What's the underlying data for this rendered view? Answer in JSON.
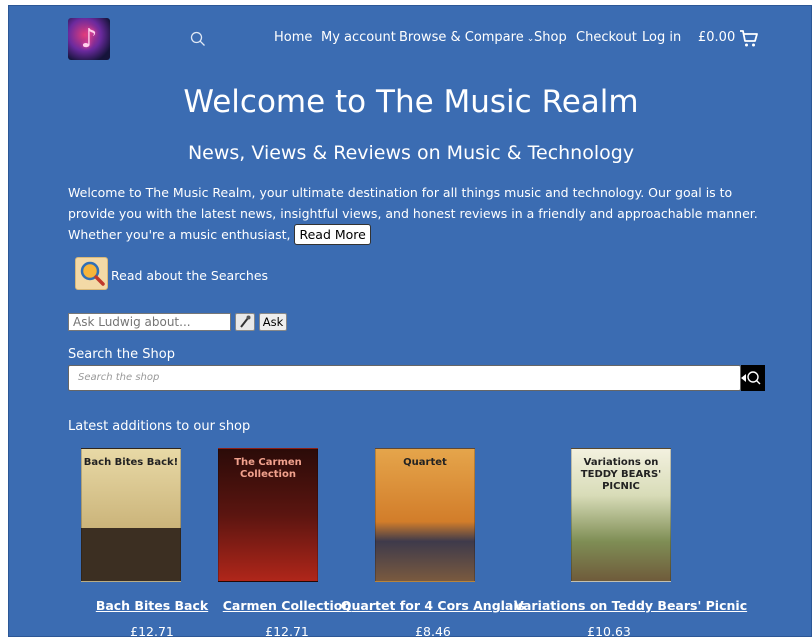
{
  "header": {
    "nav": [
      "Home",
      "My account",
      "Browse & Compare",
      "Shop",
      "Checkout",
      "Log in"
    ],
    "cart_total": "£0.00"
  },
  "hero": {
    "title": "Welcome to The Music Realm",
    "subtitle": "News, Views & Reviews on Music & Technology",
    "intro": "Welcome to The Music Realm, your ultimate destination for all things music and technology. Our goal is to provide you with the latest news, insightful views, and honest reviews in a friendly and approachable manner. Whether you're a music enthusiast,",
    "read_more": "Read More"
  },
  "about_link": "Read about the Searches",
  "ask": {
    "placeholder": "Ask Ludwig about...",
    "button": "Ask"
  },
  "shop_search": {
    "label": "Search the Shop",
    "placeholder": "Search the shop"
  },
  "latest_label": "Latest additions to our shop",
  "products": [
    {
      "name": "Bach Bites Back",
      "price": "£12.71",
      "cover_text": "Bach Bites Back!"
    },
    {
      "name": "Carmen Collection",
      "price": "£12.71",
      "cover_text": "The Carmen Collection"
    },
    {
      "name": "Quartet for 4 Cors Anglais",
      "price": "£8.46",
      "cover_text": "Quartet"
    },
    {
      "name": "Variations on Teddy Bears' Picnic",
      "price": "£10.63",
      "cover_text": "Variations on TEDDY BEARS' PICNIC"
    }
  ],
  "colors": {
    "background": "#3b6cb2",
    "text": "#ffffff"
  }
}
